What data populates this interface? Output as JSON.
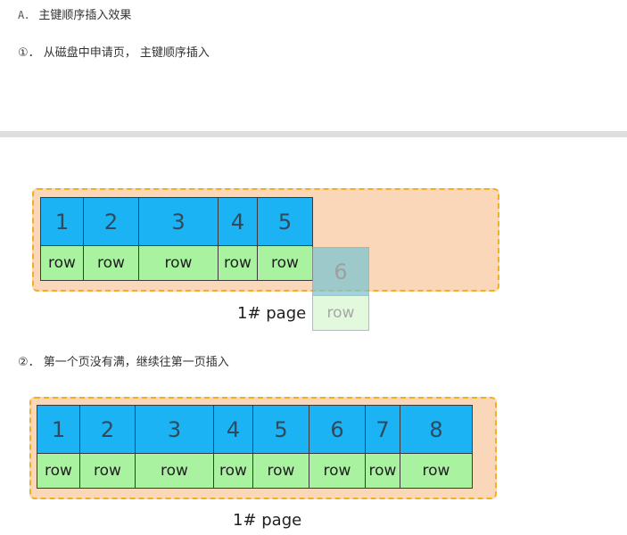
{
  "heading": {
    "prefix": "A．",
    "text": "主键顺序插入效果"
  },
  "step1": {
    "marker": "①．",
    "text": "从磁盘中申请页， 主键顺序插入"
  },
  "step2": {
    "marker": "②．",
    "text": "第一个页没有满，继续往第一页插入"
  },
  "diagram1": {
    "cells": [
      {
        "key": "1",
        "value": "row"
      },
      {
        "key": "2",
        "value": "row"
      },
      {
        "key": "3",
        "value": "row"
      },
      {
        "key": "4",
        "value": "row"
      },
      {
        "key": "5",
        "value": "row"
      }
    ],
    "incoming": {
      "key": "6",
      "value": "row"
    },
    "page_label": "1#  page"
  },
  "diagram2": {
    "cells": [
      {
        "key": "1",
        "value": "row"
      },
      {
        "key": "2",
        "value": "row"
      },
      {
        "key": "3",
        "value": "row"
      },
      {
        "key": "4",
        "value": "row"
      },
      {
        "key": "5",
        "value": "row"
      },
      {
        "key": "6",
        "value": "row"
      },
      {
        "key": "7",
        "value": "row"
      },
      {
        "key": "8",
        "value": "row"
      }
    ],
    "page_label": "1#  page"
  },
  "colors": {
    "key_cell": "#1bb3f3",
    "row_cell": "#a8f2a0",
    "page_fill": "#fad7b8",
    "page_border": "#f2b01e"
  }
}
